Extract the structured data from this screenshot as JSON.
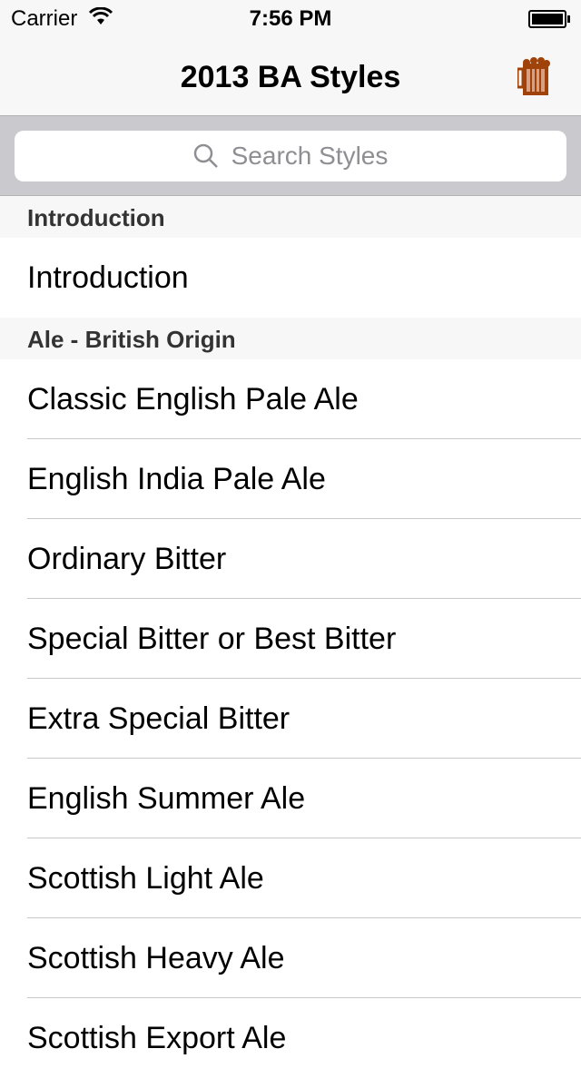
{
  "status_bar": {
    "carrier": "Carrier",
    "time": "7:56 PM"
  },
  "nav": {
    "title": "2013 BA Styles",
    "right_icon": "beer-mug-icon",
    "accent": "#a0430a"
  },
  "search": {
    "placeholder": "Search Styles"
  },
  "sections": [
    {
      "header": "Introduction",
      "items": [
        "Introduction"
      ]
    },
    {
      "header": "Ale - British Origin",
      "items": [
        "Classic English Pale Ale",
        "English India Pale Ale",
        "Ordinary Bitter",
        "Special Bitter or Best Bitter",
        "Extra Special Bitter",
        "English Summer Ale",
        "Scottish Light Ale",
        "Scottish Heavy Ale",
        "Scottish Export Ale"
      ]
    }
  ]
}
